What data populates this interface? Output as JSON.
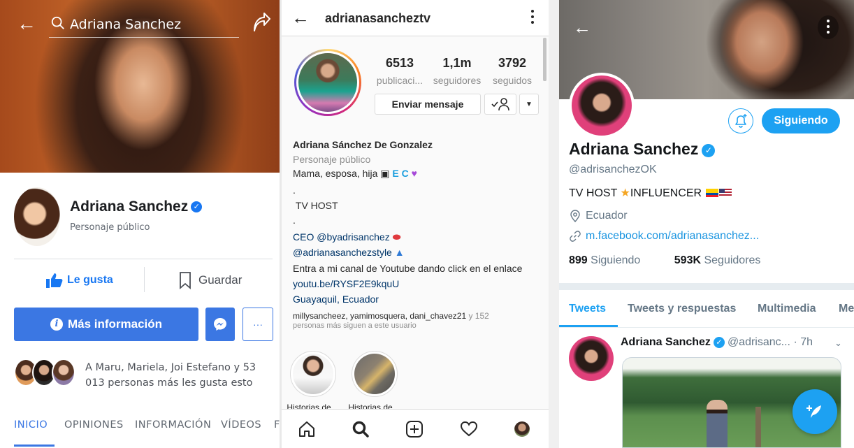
{
  "facebook": {
    "search_text": "Adriana Sanchez",
    "profile_name": "Adriana Sanchez",
    "profile_category": "Personaje público",
    "like_label": "Le gusta",
    "save_label": "Guardar",
    "more_info_label": "Más información",
    "more_label": "···",
    "likes_text": "A Maru, Mariela, Joi Estefano y 53 013 personas más les gusta esto",
    "tabs": [
      "INICIO",
      "OPINIONES",
      "INFORMACIÓN",
      "VÍDEOS",
      "F"
    ],
    "active_tab": "INICIO",
    "accent_color": "#3b77e3"
  },
  "instagram": {
    "handle": "adrianasancheztv",
    "stats": [
      {
        "value": "6513",
        "label": "publicaci..."
      },
      {
        "value": "1,1m",
        "label": "seguidores"
      },
      {
        "value": "3792",
        "label": "seguidos"
      }
    ],
    "message_label": "Enviar mensaje",
    "full_name": "Adriana Sánchez De Gonzalez",
    "category": "Personaje público",
    "bio_line1": "Mama, esposa, hija",
    "bio_ec": "E C",
    "bio_dot1": ".",
    "bio_tvhost": "TV HOST",
    "bio_dot2": ".",
    "bio_ceo": "CEO @byadrisanchez",
    "bio_style": "@adrianasanchezstyle",
    "bio_youtube": "Entra a mi canal de Youtube dando click en el enlace",
    "link": "youtu.be/RYSF2E9kquU",
    "location": "Guayaquil, Ecuador",
    "followed_by_names": "millysancheez, yamimosquera, dani_chavez21",
    "followed_by_more": " y 152",
    "followed_by_suffix": "personas más siguen a este usuario",
    "stories": [
      {
        "label": "Historias de..."
      },
      {
        "label": "Historias de..."
      }
    ]
  },
  "twitter": {
    "follow_label": "Siguiendo",
    "name": "Adriana Sanchez",
    "handle": "@adrisanchezOK",
    "bio_tv": "TV HOST ",
    "bio_influencer": "INFLUENCER",
    "location": "Ecuador",
    "url": "m.facebook.com/adrianasanchez...",
    "following_count": "899",
    "following_label": "Siguiendo",
    "followers_count": "593K",
    "followers_label": "Seguidores",
    "tabs": [
      "Tweets",
      "Tweets y respuestas",
      "Multimedia",
      "Me"
    ],
    "active_tab": "Tweets",
    "tweet_author": "Adriana Sanchez",
    "tweet_handle": "@adrisanc...",
    "tweet_time": "· 7h",
    "accent_color": "#1da1f2"
  }
}
